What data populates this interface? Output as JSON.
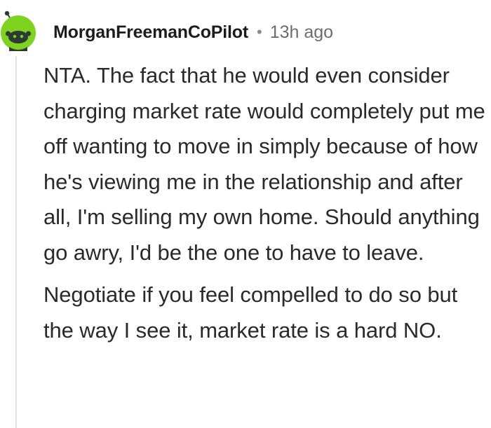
{
  "comment": {
    "author": "MorganFreemanCoPilot",
    "separator": "•",
    "timestamp": "13h ago",
    "avatar_icon": "reddit-snoo-avatar-icon",
    "paragraphs": [
      "NTA. The fact that he would even consider charging market rate would completely put me off wanting to move in simply because of how he's viewing me in the relationship and after all, I'm selling my own home. Should anything go awry, I'd be the one to have to leave.",
      "Negotiate if you feel compelled to do so but the way I see it, market rate is a hard NO."
    ]
  },
  "colors": {
    "avatar_green": "#7ed321",
    "avatar_dark": "#2d3b36",
    "thread_line": "#e4e4e4",
    "meta_gray": "#6b6d70"
  }
}
